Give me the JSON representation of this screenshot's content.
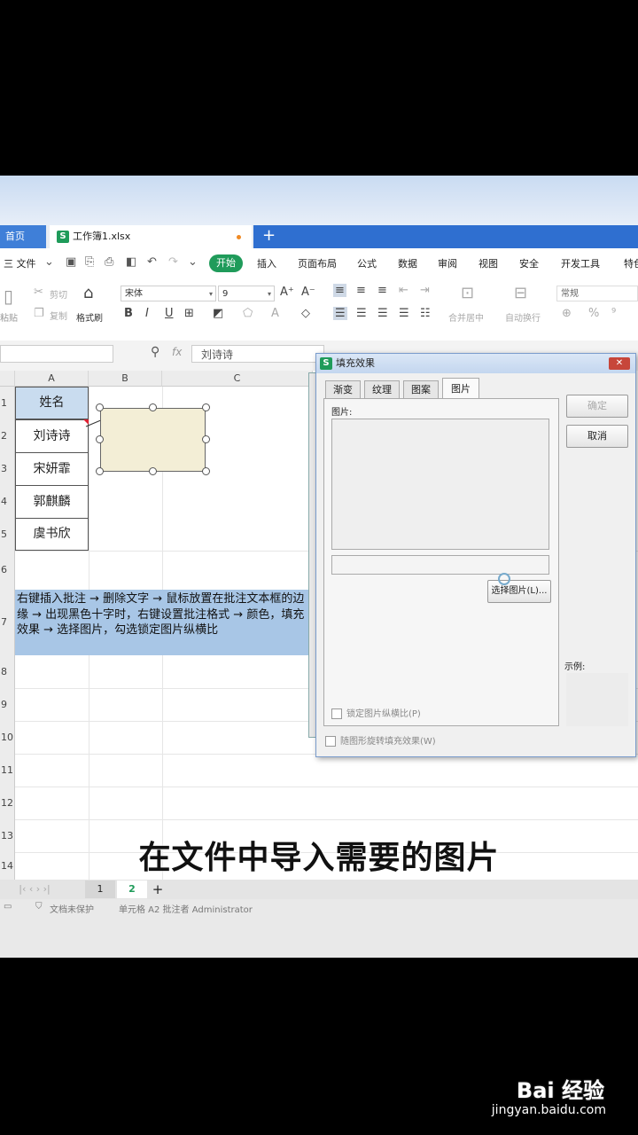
{
  "tabs": {
    "home": "首页",
    "file_badge": "S",
    "file": "工作簿1.xlsx",
    "new_tab": "+"
  },
  "menu": {
    "file": "三 文件",
    "items": [
      "开始",
      "插入",
      "页面布局",
      "公式",
      "数据",
      "审阅",
      "视图",
      "安全",
      "开发工具",
      "特色"
    ]
  },
  "toolbar": {
    "paste": "粘贴",
    "cut": "剪切",
    "copy": "复制",
    "format_painter": "格式刷",
    "font_name": "宋体",
    "font_size": "9",
    "merge": "合并居中",
    "wrap": "自动换行",
    "number_format": "常规",
    "grow_font": "A⁺",
    "shrink_font": "A⁻",
    "bold": "B",
    "italic": "I",
    "underline": "U",
    "percent": "%"
  },
  "formula": {
    "fx": "fx",
    "value": "刘诗诗"
  },
  "columns": [
    "A",
    "B",
    "C"
  ],
  "rows": [
    "1",
    "2",
    "3",
    "4",
    "5",
    "6",
    "7",
    "8",
    "9",
    "10",
    "11",
    "12",
    "13",
    "14"
  ],
  "cells": {
    "header": "姓名",
    "names": [
      "刘诗诗",
      "宋妍霏",
      "郭麒麟",
      "虞书欣"
    ]
  },
  "instruction_note": "右键插入批注 → 删除文字 → 鼠标放置在批注文本框的边缘 → 出现黑色十字时，右键设置批注格式 → 颜色，填充效果 → 选择图片，勾选锁定图片纵横比",
  "sheet_tabs": [
    "1",
    "2"
  ],
  "sheet_add": "+",
  "status": {
    "protect": "文档未保护",
    "cell_info": "单元格 A2 批注者 Administrator"
  },
  "dialog": {
    "badge": "S",
    "title": "填充效果",
    "close": "✕",
    "tabs": [
      "渐变",
      "纹理",
      "图案",
      "图片"
    ],
    "picture_label": "图片:",
    "select_button": "选择图片(L)...",
    "ok": "确定",
    "cancel": "取消",
    "sample_label": "示例:",
    "lock_ratio": "锁定图片纵横比(P)",
    "rotate_with_shape": "随图形旋转填充效果(W)"
  },
  "caption": "在文件中导入需要的图片",
  "watermark": {
    "brand": "Bai 经验",
    "url": "jingyan.baidu.com"
  },
  "colors": {
    "accent_green": "#1f9b5a",
    "tab_blue": "#2f6fd0",
    "note_fill": "#a8c6e6",
    "shape_fill": "#f3eed6"
  }
}
